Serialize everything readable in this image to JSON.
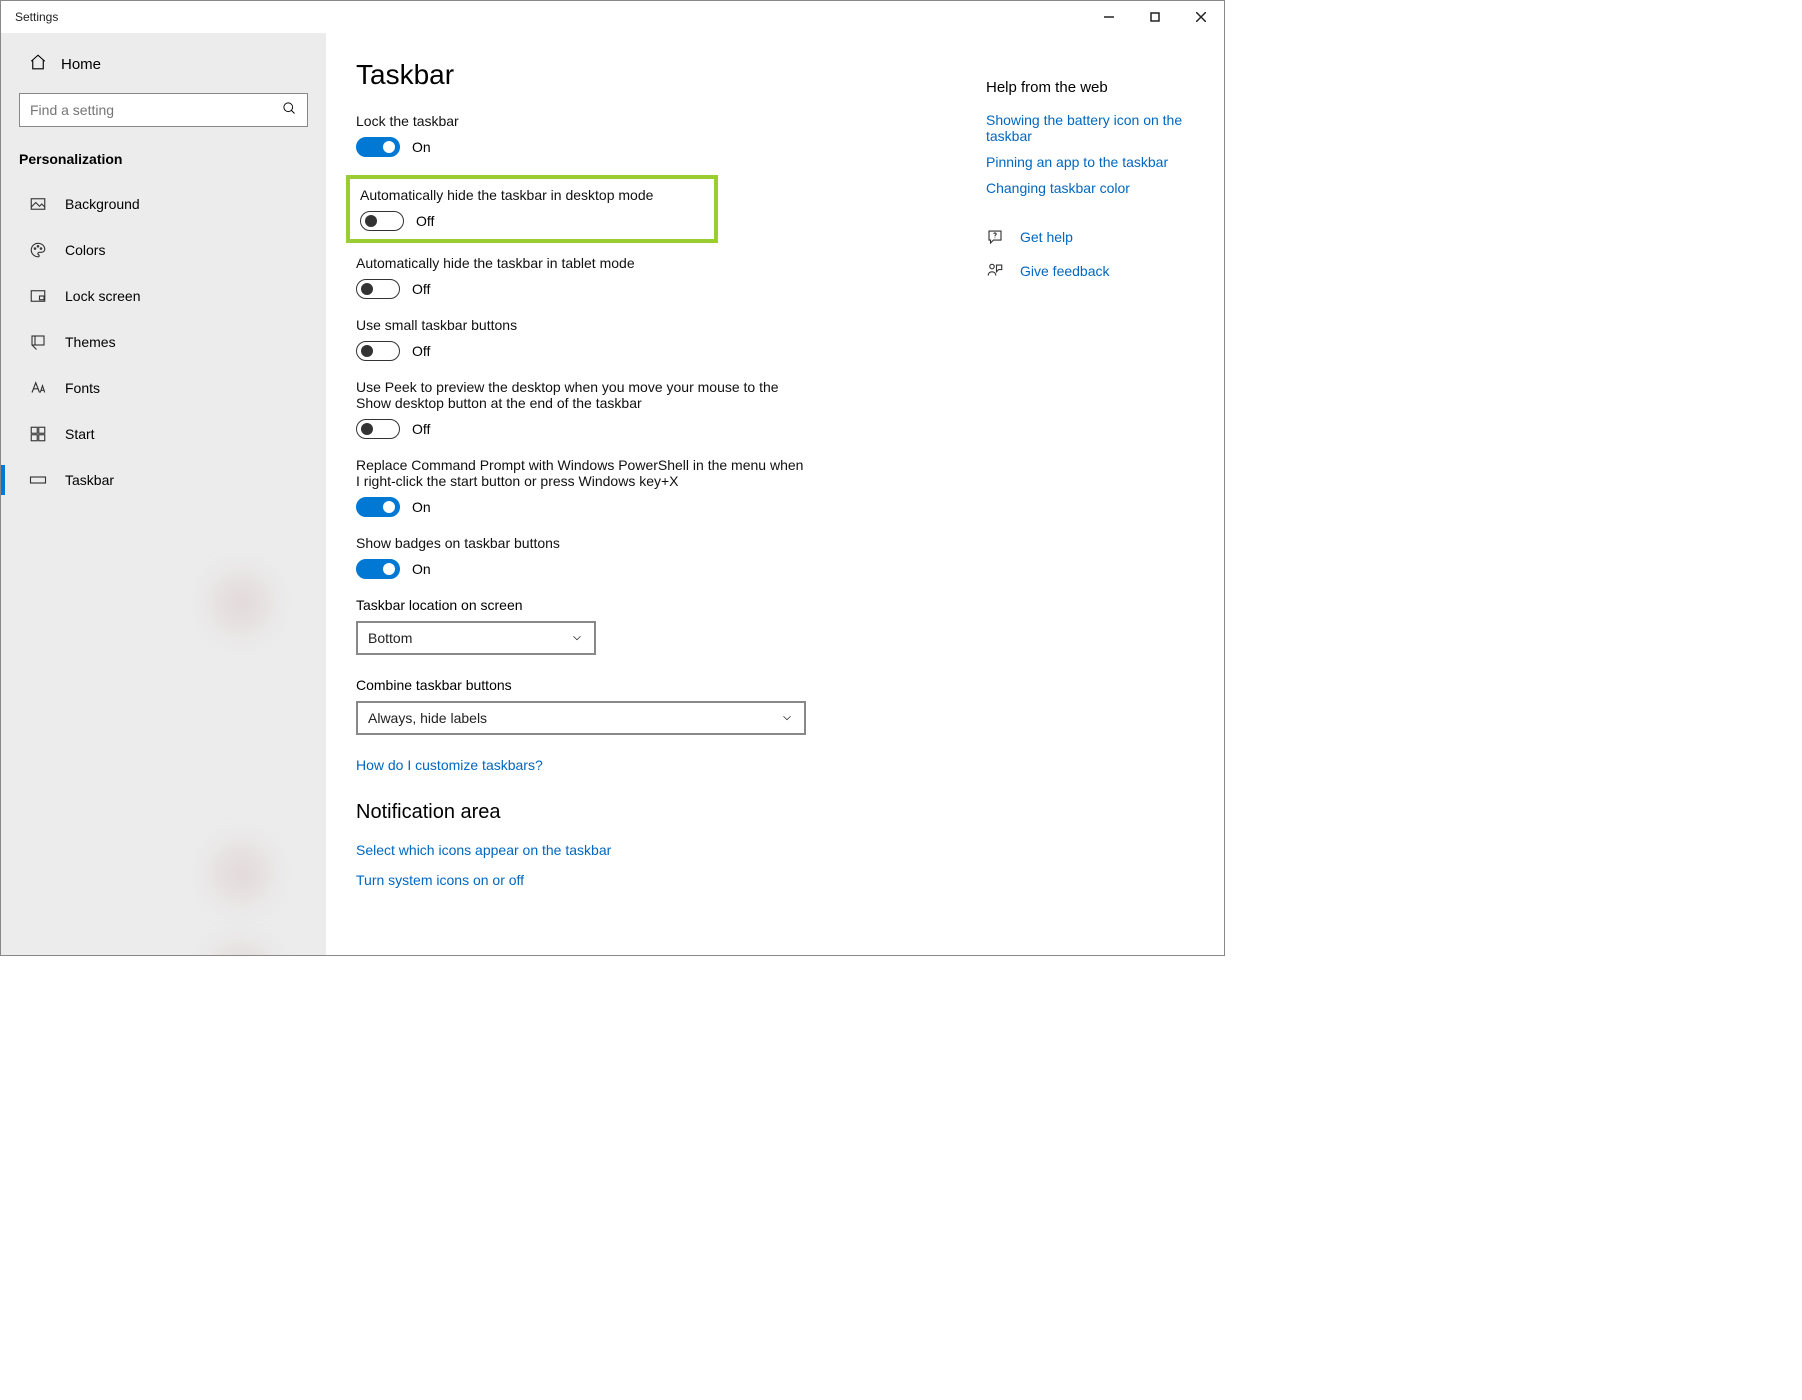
{
  "window": {
    "title": "Settings"
  },
  "sidebar": {
    "home": "Home",
    "search_placeholder": "Find a setting",
    "category": "Personalization",
    "items": [
      {
        "label": "Background"
      },
      {
        "label": "Colors"
      },
      {
        "label": "Lock screen"
      },
      {
        "label": "Themes"
      },
      {
        "label": "Fonts"
      },
      {
        "label": "Start"
      },
      {
        "label": "Taskbar"
      }
    ]
  },
  "page": {
    "title": "Taskbar",
    "toggles": [
      {
        "label": "Lock the taskbar",
        "state": "On",
        "on": true
      },
      {
        "label": "Automatically hide the taskbar in desktop mode",
        "state": "Off",
        "on": false
      },
      {
        "label": "Automatically hide the taskbar in tablet mode",
        "state": "Off",
        "on": false
      },
      {
        "label": "Use small taskbar buttons",
        "state": "Off",
        "on": false
      },
      {
        "label": "Use Peek to preview the desktop when you move your mouse to the Show desktop button at the end of the taskbar",
        "state": "Off",
        "on": false
      },
      {
        "label": "Replace Command Prompt with Windows PowerShell in the menu when I right-click the start button or press Windows key+X",
        "state": "On",
        "on": true
      },
      {
        "label": "Show badges on taskbar buttons",
        "state": "On",
        "on": true
      }
    ],
    "selects": [
      {
        "label": "Taskbar location on screen",
        "value": "Bottom"
      },
      {
        "label": "Combine taskbar buttons",
        "value": "Always, hide labels"
      }
    ],
    "customize_link": "How do I customize taskbars?",
    "section2_title": "Notification area",
    "section2_links": [
      "Select which icons appear on the taskbar",
      "Turn system icons on or off"
    ]
  },
  "aside": {
    "title": "Help from the web",
    "links": [
      "Showing the battery icon on the taskbar",
      "Pinning an app to the taskbar",
      "Changing taskbar color"
    ],
    "actions": [
      "Get help",
      "Give feedback"
    ]
  }
}
